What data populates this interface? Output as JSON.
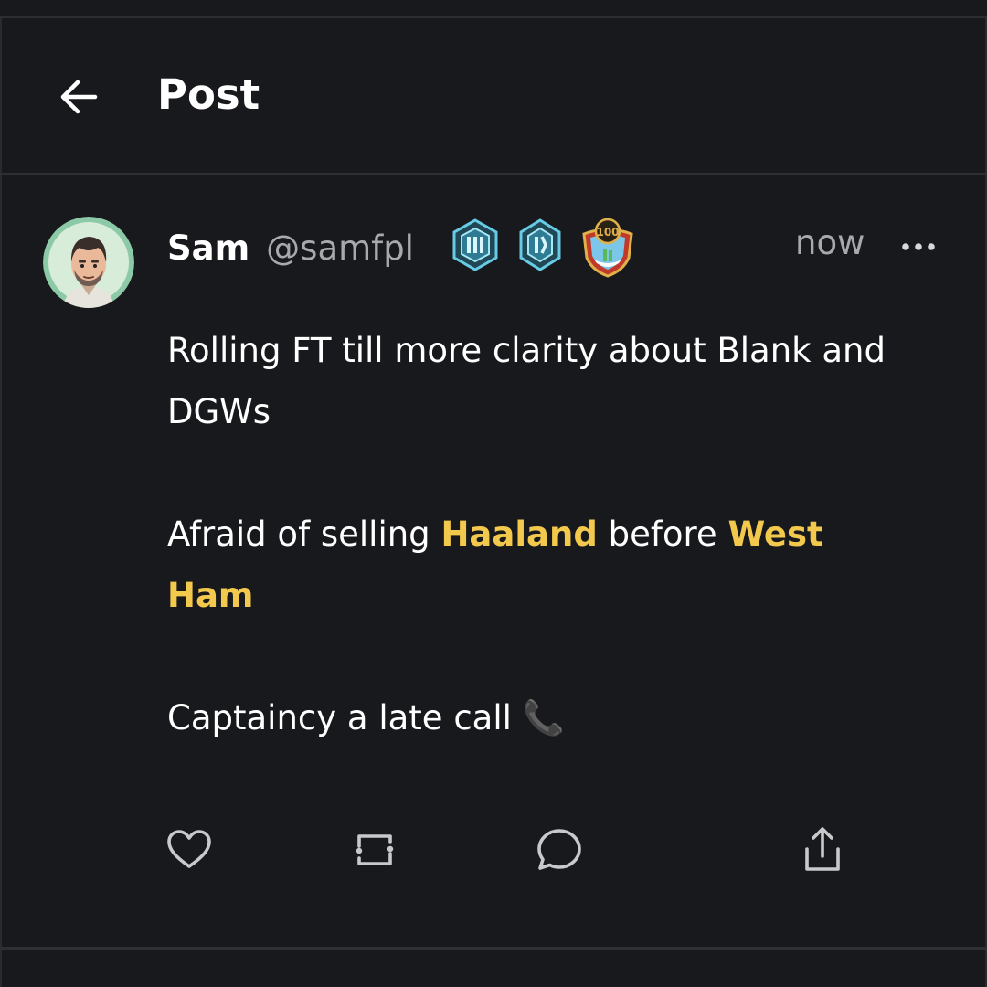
{
  "header": {
    "title": "Post",
    "back_icon": "arrow-left-icon"
  },
  "post": {
    "author": {
      "name": "Sam",
      "handle": "@samfpl",
      "avatar_icon": "user-avatar-cartoon"
    },
    "badges": [
      {
        "icon": "hexagon-badge-icon",
        "color": "#5fc3df"
      },
      {
        "icon": "hexagon-badge-icon",
        "color": "#5fc3df"
      },
      {
        "icon": "shield-100-badge-icon",
        "label": "100",
        "color": "#c9a640"
      }
    ],
    "timestamp": "now",
    "more_icon": "ellipsis-icon",
    "body": {
      "p1": "Rolling FT till more clarity about Blank and DGWs",
      "p2_before": "Afraid of selling ",
      "p2_mention1": "Haaland",
      "p2_middle": " before ",
      "p2_mention2": "West Ham",
      "p3": "Captaincy a late call ",
      "p3_emoji": "📞"
    },
    "mention_color": "#f2c94c"
  },
  "actions": [
    {
      "name": "like",
      "icon": "heart-icon"
    },
    {
      "name": "repost",
      "icon": "repost-icon"
    },
    {
      "name": "reply",
      "icon": "speech-bubble-icon"
    },
    {
      "name": "share",
      "icon": "share-icon"
    }
  ]
}
